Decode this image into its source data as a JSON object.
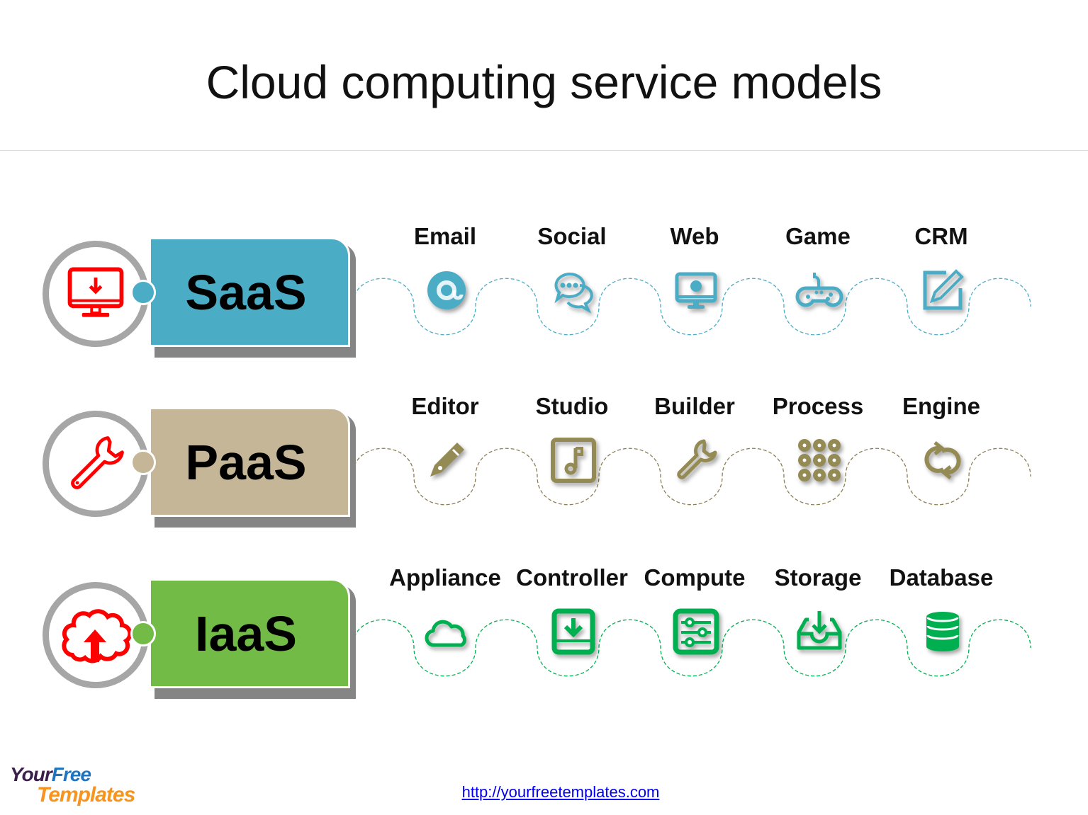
{
  "title": "Cloud computing service models",
  "colors": {
    "saas": "#4bacc6",
    "paas": "#c4b696",
    "iaas": "#72bb46",
    "saas_icon": "#4bacc6",
    "paas_icon": "#948a54",
    "iaas_icon": "#00b050",
    "ring_icon": "#ff0000",
    "ring": "#a6a6a6"
  },
  "models": [
    {
      "name": "SaaS",
      "ring_icon": "monitor-download-icon",
      "items": [
        {
          "label": "Email",
          "icon": "at-sign-icon"
        },
        {
          "label": "Social",
          "icon": "chat-bubbles-icon"
        },
        {
          "label": "Web",
          "icon": "monitor-globe-icon"
        },
        {
          "label": "Game",
          "icon": "gamepad-icon"
        },
        {
          "label": "CRM",
          "icon": "edit-square-icon"
        }
      ]
    },
    {
      "name": "PaaS",
      "ring_icon": "wrench-icon",
      "items": [
        {
          "label": "Editor",
          "icon": "pencil-icon"
        },
        {
          "label": "Studio",
          "icon": "music-note-icon"
        },
        {
          "label": "Builder",
          "icon": "wrench-icon"
        },
        {
          "label": "Process",
          "icon": "dots-grid-icon"
        },
        {
          "label": "Engine",
          "icon": "sync-icon"
        }
      ]
    },
    {
      "name": "IaaS",
      "ring_icon": "cloud-upload-icon",
      "items": [
        {
          "label": "Appliance",
          "icon": "cloud-icon"
        },
        {
          "label": "Controller",
          "icon": "download-box-icon"
        },
        {
          "label": "Compute",
          "icon": "sliders-icon"
        },
        {
          "label": "Storage",
          "icon": "inbox-download-icon"
        },
        {
          "label": "Database",
          "icon": "database-icon"
        }
      ]
    }
  ],
  "footer": {
    "logo_line1_a": "Your",
    "logo_line1_b": "Free",
    "logo_line2": "Templates",
    "link": "http://yourfreetemplates.com"
  }
}
